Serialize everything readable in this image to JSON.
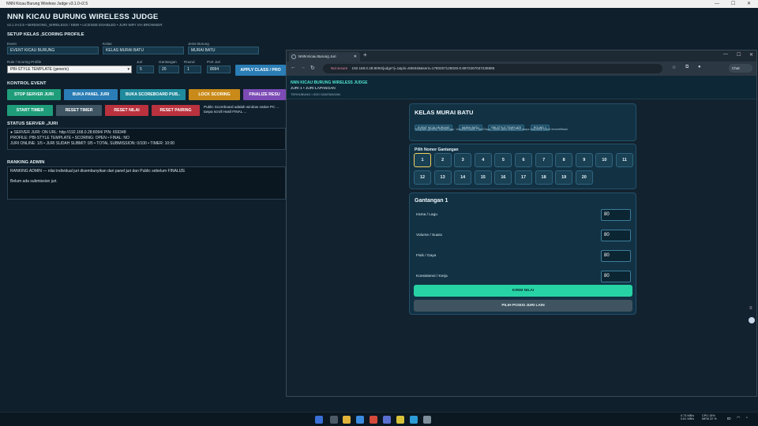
{
  "window": {
    "title": "NNN Kicau Burung Wireless Judge v3.1.0-r2.5",
    "minimize": "—",
    "maximize": "☐",
    "close": "✕"
  },
  "header": {
    "title": "NNN KICAU BURUNG WIRELESS JUDGE",
    "subtitle": "v3.1.0-r2.5  •  BIRDSONG_WIRELESS / KBW  •  LICENSE ENABLED  •  JURI WIFI VIA BROWSER"
  },
  "setup": {
    "heading": "SETUP KELAS ,SCORING PROFILE",
    "event_label": "Event",
    "event_value": "EVENT KICAU BURUNG",
    "kelas_label": "Kelas",
    "kelas_value": "KELAS MURAI BATU",
    "jenis_label": "Jenis Burung",
    "jenis_value": "MURAI BATU",
    "rule_label": "Rule / Scoring Profile",
    "rule_value": "PBI-STYLE TEMPLATE (generic)",
    "juri_label": "Juri",
    "juri_value": "5",
    "gantangan_label": "Gantangan",
    "gantangan_value": "20",
    "round_label": "Round",
    "round_value": "1",
    "port_label": "Port Juri",
    "port_value": "8094",
    "apply_button": "APPLY CLASS / PRO"
  },
  "kontrol": {
    "heading": "KONTROL EVENT",
    "buttons": [
      {
        "label": "STOP SERVER JURI",
        "color": "#1f9d7a"
      },
      {
        "label": "BUKA PANEL JURI",
        "color": "#2a7db5"
      },
      {
        "label": "BUKA SCOREBOARD PUB..",
        "color": "#1f8a9c"
      },
      {
        "label": "LOCK SCORING",
        "color": "#c98a1a"
      },
      {
        "label": "FINALIZE RESU",
        "color": "#7c4bb5"
      },
      {
        "label": "START TIMER",
        "color": "#1f9d7a"
      },
      {
        "label": "RESET TIMER",
        "color": "#3f5563"
      },
      {
        "label": "RESET NILAI",
        "color": "#b9323e"
      },
      {
        "label": "RESET PAIRING",
        "color": "#b9323e"
      }
    ],
    "note": "Public Scoreboard adalah window native PC ... tanpa scroll Hasil FINAL ..."
  },
  "status": {
    "heading": "STATUS SERVER ,JURI",
    "line1": "● SERVER JURI: ON    URL: http://192.168.0.28:8094/    PIN: 659348",
    "line2": "PROFILE: PBI-STYLE TEMPLATE   •   SCORING: OPEN   •   FINAL: NO",
    "line3": "JURI ONLINE: 1/5   •   JURI SUDAH SUBMIT: 0/5   •   TOTAL SUBMISSION: 0/100   •   TIMER: 10:00"
  },
  "ranking": {
    "heading": "RANKING ADMIN",
    "line1": "RANKING ADMIN — nilai individual juri disembunyikan dari panel juri dan Public sebelum FINALIZE",
    "line2": "Belum ada submission juri."
  },
  "browser": {
    "tab_title": "NNN Kicau Burung Juri",
    "new_tab": "+",
    "security": "Not secure",
    "url": "192.168.0.28:8094/judge?j=1&pin=659348&sent=1780257129025-0.8972267037236886",
    "chat_label": "Chat"
  },
  "judge_page": {
    "brand": "NNN KICAU BURUNG WIRELESS JUDGE",
    "juri_line": "JURI 1 • JURI LAPANGAN",
    "sub_line": "TERHUBUNG • 0/20 GANTANGAN",
    "class_title": "KELAS MURAI BATU",
    "chips": [
      "EVENT KICAU BURUNG",
      "MURAI BATU",
      "PBI-STYLE TEMPLATE",
      "ROUND 1"
    ],
    "template_note": "Template generik: Irama/Lagu, Volume/Suara, Fisik/Gaya, Roleh label resmi PBI tanpa dokumen event tersertifikasi.",
    "pilih_heading": "Pilih Nomor Gantangan",
    "numbers": [
      "1",
      "2",
      "3",
      "4",
      "5",
      "6",
      "7",
      "8",
      "9",
      "10",
      "11",
      "12",
      "13",
      "14",
      "15",
      "16",
      "17",
      "18",
      "19",
      "20"
    ],
    "selected": "1",
    "gantangan_title": "Gantangan 1",
    "criteria": [
      {
        "label": "Irama / Lagu",
        "value": "80"
      },
      {
        "label": "Volume / Suara",
        "value": "80"
      },
      {
        "label": "Fisik / Gaya",
        "value": "80"
      },
      {
        "label": "Konsistensi / Kerja",
        "value": "80"
      }
    ],
    "submit_button": "KIRIM NILAI",
    "switch_button": "PILIH POSISI JURI LAIN"
  },
  "taskbar": {
    "weather": "0.73 MB/s",
    "weather2": "0.61 MB/s",
    "cpu": "CPU 15%",
    "mem": "MEM 22 %",
    "lang": "ID",
    "time": "",
    "date": ""
  }
}
